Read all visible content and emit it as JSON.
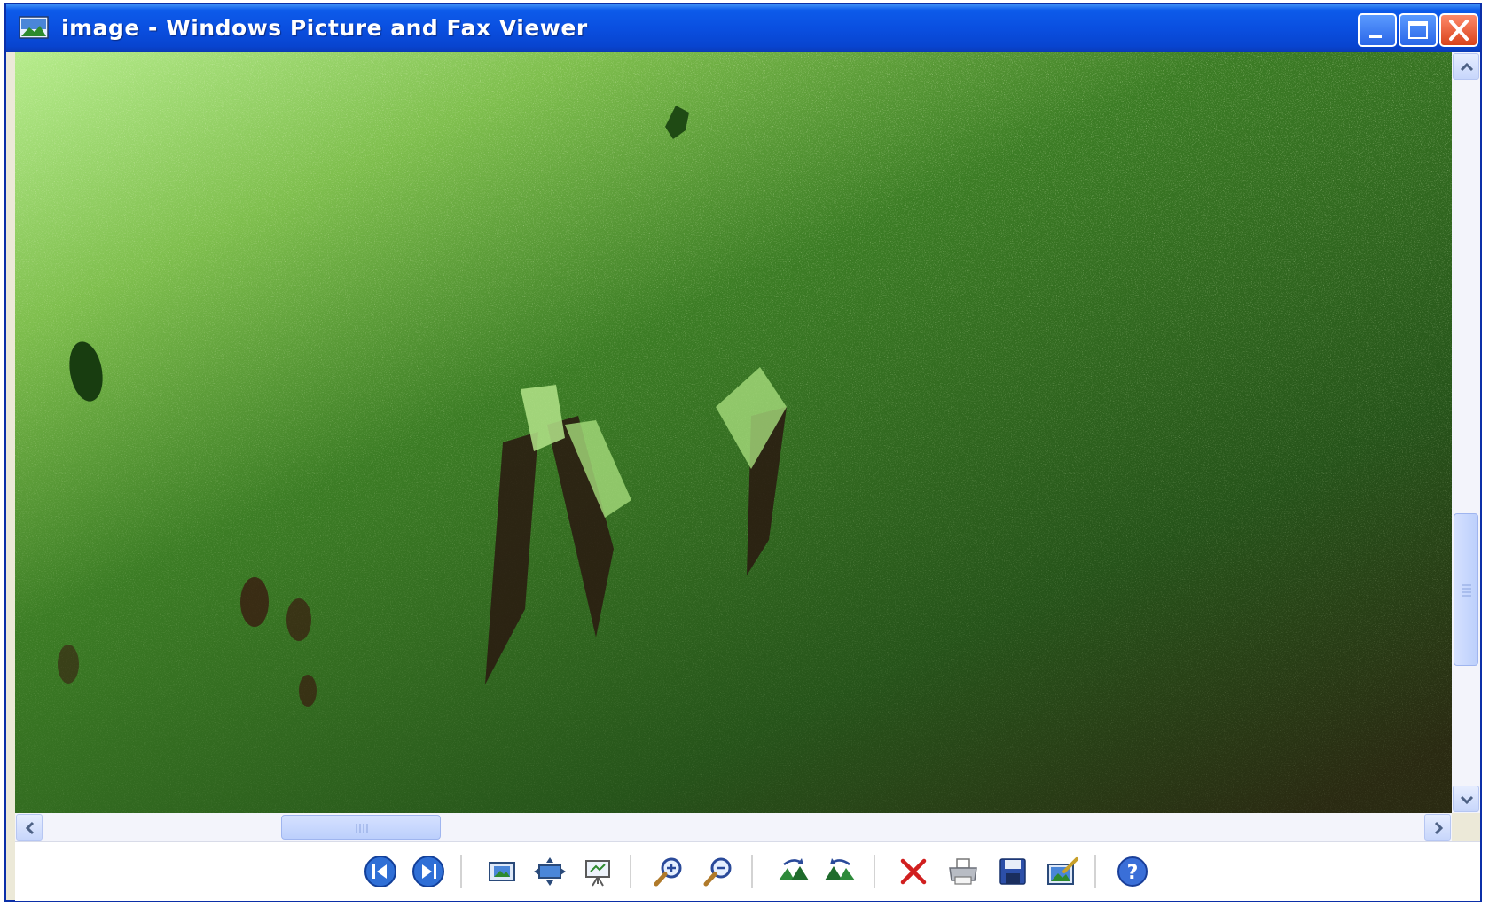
{
  "window": {
    "title": "image - Windows Picture and Fax Viewer",
    "title_color": "#ffffff",
    "titlebar_color": "#0a4fe0"
  },
  "viewer": {
    "image_tint": "#3a7a22",
    "scroll": {
      "vertical_position": 0.6,
      "horizontal_position": 0.2
    }
  },
  "toolbar": {
    "buttons": [
      {
        "name": "previous-image",
        "icon": "previous-icon"
      },
      {
        "name": "next-image",
        "icon": "next-icon"
      },
      {
        "name": "best-fit",
        "icon": "best-fit-icon"
      },
      {
        "name": "actual-size",
        "icon": "actual-size-icon"
      },
      {
        "name": "slide-show",
        "icon": "slideshow-icon"
      },
      {
        "name": "zoom-in",
        "icon": "zoom-in-icon"
      },
      {
        "name": "zoom-out",
        "icon": "zoom-out-icon"
      },
      {
        "name": "rotate-clockwise",
        "icon": "rotate-clockwise-icon"
      },
      {
        "name": "rotate-counterclockwise",
        "icon": "rotate-counterclockwise-icon"
      },
      {
        "name": "delete",
        "icon": "delete-icon"
      },
      {
        "name": "print",
        "icon": "print-icon"
      },
      {
        "name": "save",
        "icon": "save-icon"
      },
      {
        "name": "edit",
        "icon": "edit-icon"
      },
      {
        "name": "help",
        "icon": "help-icon"
      }
    ]
  }
}
